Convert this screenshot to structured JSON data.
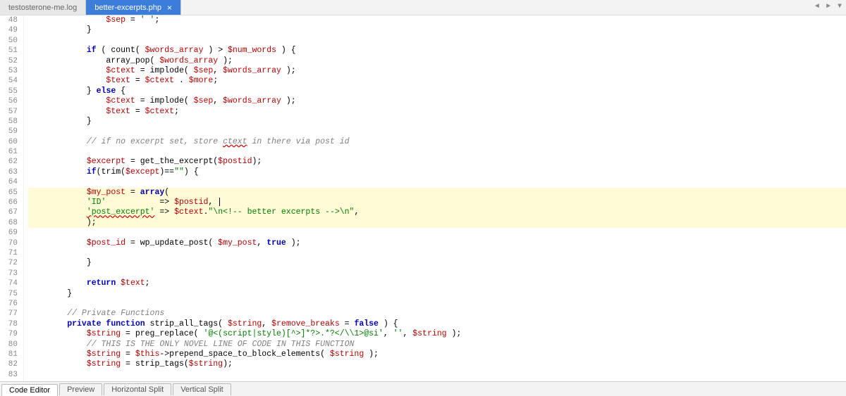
{
  "tabs": {
    "tab0": "testosterone-me.log",
    "tab1": "better-excerpts.php"
  },
  "nav": {
    "left": "◄",
    "right": "►",
    "down": "▼"
  },
  "gutter": {
    "start": 48,
    "end": 83
  },
  "code": {
    "l48": {
      "indent": "                ",
      "v0": "$sep",
      "op0": " = ",
      "s0": "' '",
      "op1": ";"
    },
    "l49": {
      "indent": "            ",
      "op0": "}"
    },
    "l50": {
      "indent": ""
    },
    "l51": {
      "indent": "            ",
      "kw0": "if",
      "op0": " ( count( ",
      "v0": "$words_array",
      "op1": " ) > ",
      "v1": "$num_words",
      "op2": " ) {"
    },
    "l52": {
      "indent": "                ",
      "fn0": "array_pop( ",
      "v0": "$words_array",
      "op0": " );"
    },
    "l53": {
      "indent": "                ",
      "v0": "$ctext",
      "op0": " = implode( ",
      "v1": "$sep",
      "op1": ", ",
      "v2": "$words_array",
      "op2": " );"
    },
    "l54": {
      "indent": "                ",
      "v0": "$text",
      "op0": " = ",
      "v1": "$ctext",
      "op1": " . ",
      "v2": "$more",
      "op2": ";"
    },
    "l55": {
      "indent": "            ",
      "op0": "} ",
      "kw0": "else",
      "op1": " {"
    },
    "l56": {
      "indent": "                ",
      "v0": "$ctext",
      "op0": " = implode( ",
      "v1": "$sep",
      "op1": ", ",
      "v2": "$words_array",
      "op2": " );"
    },
    "l57": {
      "indent": "                ",
      "v0": "$text",
      "op0": " = ",
      "v1": "$ctext",
      "op1": ";"
    },
    "l58": {
      "indent": "            ",
      "op0": "}"
    },
    "l59": {
      "indent": ""
    },
    "l60": {
      "indent": "            ",
      "c0": "// if no excerpt set, store ",
      "c1": "ctext",
      "c2": " in there via post id"
    },
    "l61": {
      "indent": ""
    },
    "l62": {
      "indent": "            ",
      "v0": "$excerpt",
      "op0": " = get_the_excerpt(",
      "v1": "$postid",
      "op1": ");"
    },
    "l63": {
      "indent": "            ",
      "kw0": "if",
      "op0": "(trim(",
      "v0": "$except",
      "op1": ")==",
      "s0": "\"\"",
      "op2": ") {"
    },
    "l64": {
      "indent": ""
    },
    "l65": {
      "indent": "            ",
      "v0": "$my_post",
      "op0": " = ",
      "kw0": "array",
      "op1": "("
    },
    "l66": {
      "indent": "            ",
      "s0": "'ID'",
      "sp0": "           ",
      "op0": "=> ",
      "v0": "$postid",
      "op1": ", "
    },
    "l67": {
      "indent": "            ",
      "s0": "'post_excerpt'",
      "op0": " => ",
      "v0": "$ctext",
      "op1": ".",
      "s1": "\"\\n<!-- better excerpts -->\\n\"",
      "op2": ","
    },
    "l68": {
      "indent": "            ",
      "op0": ");"
    },
    "l69": {
      "indent": ""
    },
    "l70": {
      "indent": "            ",
      "v0": "$post_id",
      "op0": " = wp_update_post( ",
      "v1": "$my_post",
      "op1": ", ",
      "kw0": "true",
      "op2": " );"
    },
    "l71": {
      "indent": ""
    },
    "l72": {
      "indent": "            ",
      "op0": "}"
    },
    "l73": {
      "indent": ""
    },
    "l74": {
      "indent": "            ",
      "kw0": "return",
      "op0": " ",
      "v0": "$text",
      "op1": ";"
    },
    "l75": {
      "indent": "        ",
      "op0": "}"
    },
    "l76": {
      "indent": ""
    },
    "l77": {
      "indent": "        ",
      "c0": "// Private Functions"
    },
    "l78": {
      "indent": "        ",
      "kw0": "private",
      "kw1": " function",
      "fn0": " strip_all_tags( ",
      "v0": "$string",
      "op0": ", ",
      "v1": "$remove_breaks",
      "op1": " = ",
      "kw2": "false",
      "op2": " ) {"
    },
    "l79": {
      "indent": "            ",
      "v0": "$string",
      "op0": " = preg_replace( ",
      "s0": "'@<(script|style)[^>]*?>.*?</\\\\1>@si'",
      "op1": ", ",
      "s1": "''",
      "op2": ", ",
      "v1": "$string",
      "op3": " );"
    },
    "l80": {
      "indent": "            ",
      "c0": "// THIS IS THE ONLY NOVEL LINE OF CODE IN THIS FUNCTION"
    },
    "l81": {
      "indent": "            ",
      "v0": "$string",
      "op0": " = ",
      "v1": "$this",
      "op1": "->prepend_space_to_block_elements( ",
      "v2": "$string",
      "op2": " );"
    },
    "l82": {
      "indent": "            ",
      "v0": "$string",
      "op0": " = strip_tags(",
      "v1": "$string",
      "op1": ");"
    },
    "l83": {
      "indent": ""
    }
  },
  "status": {
    "t0": "Code Editor",
    "t1": "Preview",
    "t2": "Horizontal Split",
    "t3": "Vertical Split"
  }
}
